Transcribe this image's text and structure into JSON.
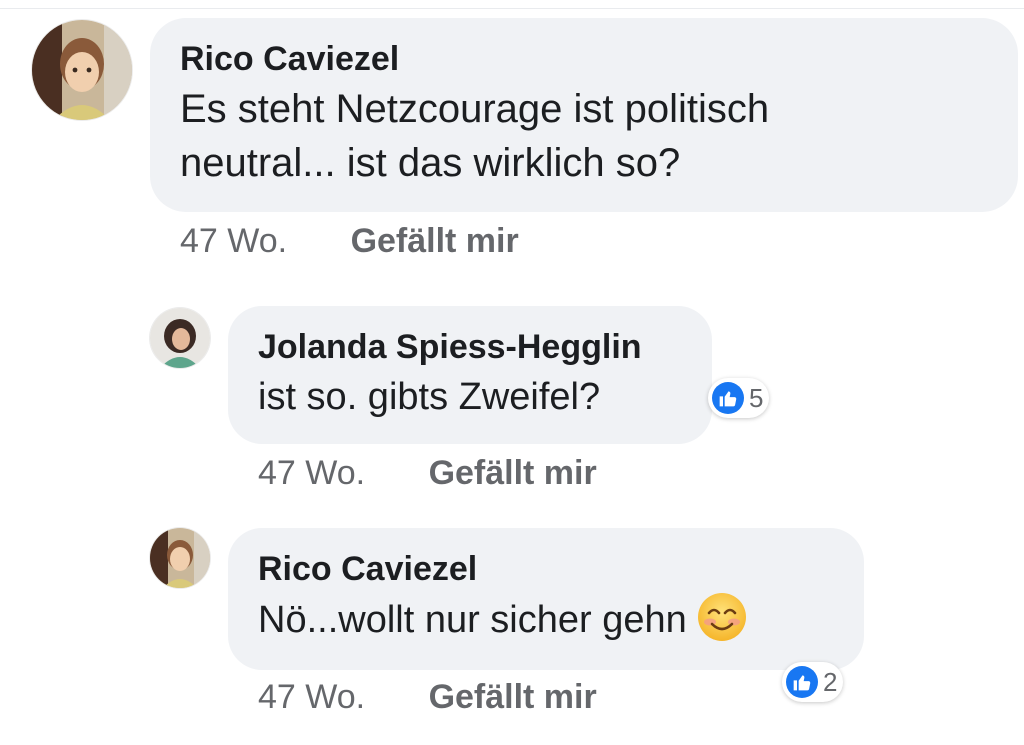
{
  "comments": [
    {
      "author": "Rico Caviezel",
      "text_line1": "Es steht Netzcourage ist politisch",
      "text_line2": "neutral... ist das wirklich so?",
      "time": "47 Wo.",
      "like_label": "Gefällt mir"
    },
    {
      "author": "Jolanda Spiess-Hegglin",
      "text": "ist so. gibts Zweifel?",
      "time": "47 Wo.",
      "like_label": "Gefällt mir",
      "reaction_count": "5"
    },
    {
      "author": "Rico Caviezel",
      "text": "Nö...wollt nur sicher gehn",
      "emoji": "smiling-face-icon",
      "time": "47 Wo.",
      "like_label": "Gefällt mir",
      "reaction_count": "2"
    }
  ],
  "colors": {
    "bubble": "#f0f2f5",
    "like_blue": "#1877f2",
    "meta_gray": "#65676b",
    "text": "#1c1e21"
  }
}
